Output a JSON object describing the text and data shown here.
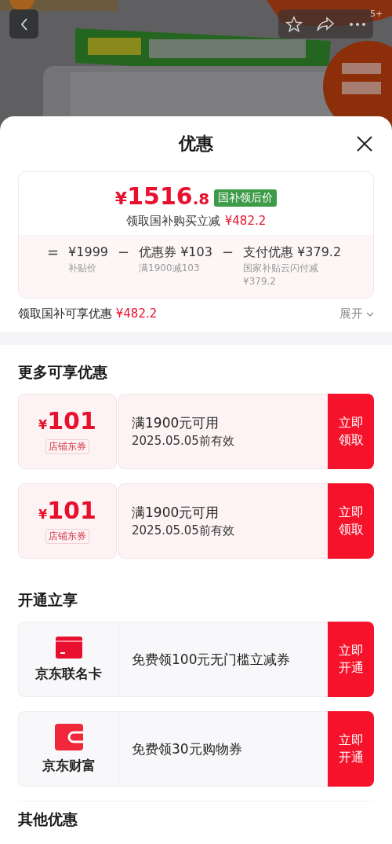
{
  "top_bar": {
    "badge": "5+"
  },
  "sheet": {
    "title": "优惠"
  },
  "summary": {
    "currency": "¥",
    "price_int": "1516",
    "price_dec": ".8",
    "tag": "国补领后价",
    "subtitle": "领取国补购买立减",
    "subtitle_amount": "¥482.2",
    "breakdown": [
      {
        "operator": "=",
        "amount": "¥1999",
        "note": "补贴价"
      },
      {
        "operator": "−",
        "label": "优惠券",
        "amount": "¥103",
        "note": "满1900减103"
      },
      {
        "operator": "−",
        "label": "支付优惠",
        "amount": "¥379.2",
        "note": "国家补贴云闪付减¥379.2"
      }
    ]
  },
  "savings_row": {
    "label": "领取国补可享优惠",
    "amount": "¥482.2",
    "expand": "展开"
  },
  "sections": [
    {
      "title": "更多可享优惠",
      "items": [
        {
          "kind": "coupon",
          "currency": "¥",
          "value": "101",
          "tag": "店铺东券",
          "condition": "满1900元可用",
          "validity": "2025.05.05前有效",
          "action": "立即领取"
        },
        {
          "kind": "coupon",
          "currency": "¥",
          "value": "101",
          "tag": "店铺东券",
          "condition": "满1900元可用",
          "validity": "2025.05.05前有效",
          "action": "立即领取"
        }
      ]
    },
    {
      "title": "开通立享",
      "items": [
        {
          "kind": "service",
          "name": "京东联名卡",
          "offer": "免费领100元无门槛立减券",
          "action": "立即开通"
        },
        {
          "kind": "service",
          "name": "京东财富",
          "offer": "免费领30元购物券",
          "action": "立即开通"
        }
      ]
    },
    {
      "title": "其他优惠"
    }
  ]
}
